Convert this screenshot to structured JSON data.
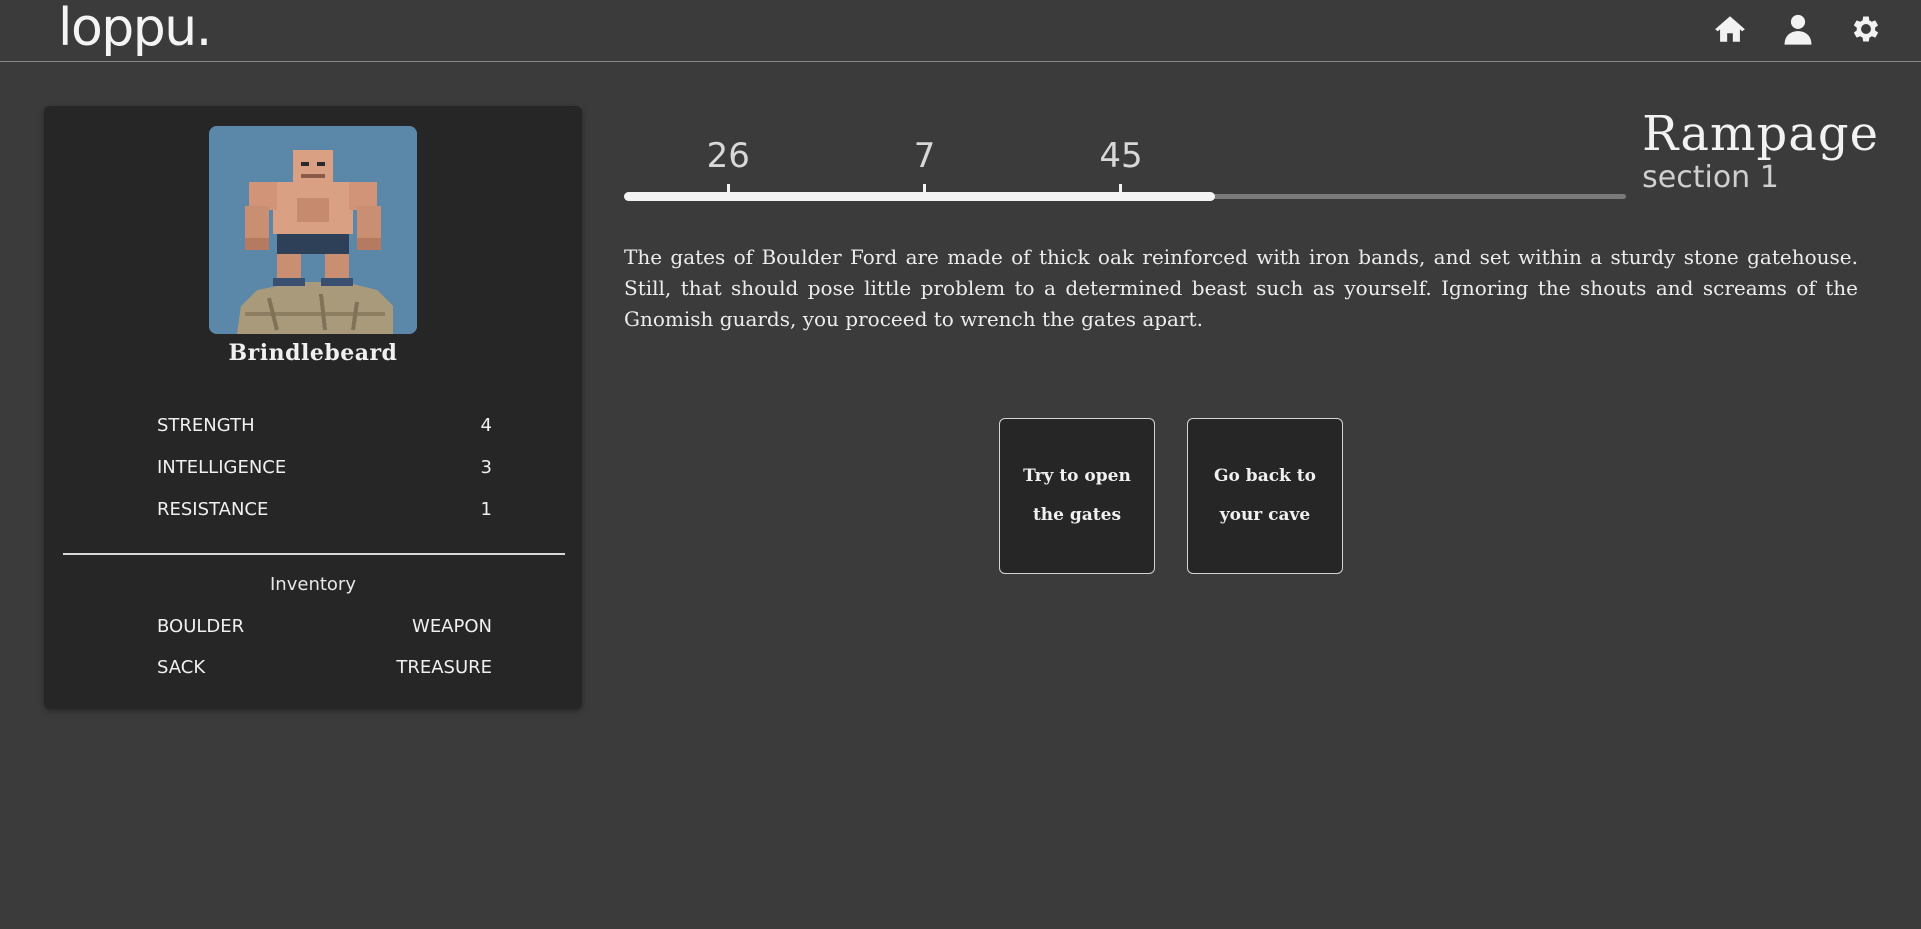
{
  "app": {
    "logo": "loppu."
  },
  "nav": {
    "icons": [
      "home-icon",
      "user-icon",
      "gear-icon"
    ]
  },
  "character": {
    "name": "Brindlebeard",
    "stats": [
      {
        "label": "STRENGTH",
        "value": "4"
      },
      {
        "label": "INTELLIGENCE",
        "value": "3"
      },
      {
        "label": "RESISTANCE",
        "value": "1"
      }
    ],
    "inventory_title": "Inventory",
    "inventory": [
      "BOULDER",
      "WEAPON",
      "SACK",
      "TREASURE"
    ]
  },
  "progress": {
    "fraction": 0.59,
    "markers": [
      {
        "label": "26",
        "position": 0.104
      },
      {
        "label": "7",
        "position": 0.3
      },
      {
        "label": "45",
        "position": 0.496
      }
    ]
  },
  "section": {
    "title": "Rampage",
    "subtitle": "section 1"
  },
  "story": {
    "text": "The gates of Boulder Ford are made of thick oak reinforced with iron bands, and set within a sturdy stone gatehouse. Still, that should pose little problem to a determined beast such as yourself. Ignoring the shouts and screams of the Gnomish guards, you proceed to wrench the gates apart."
  },
  "choices": [
    {
      "label": "Try to open the gates"
    },
    {
      "label": "Go back to your cave"
    }
  ]
}
